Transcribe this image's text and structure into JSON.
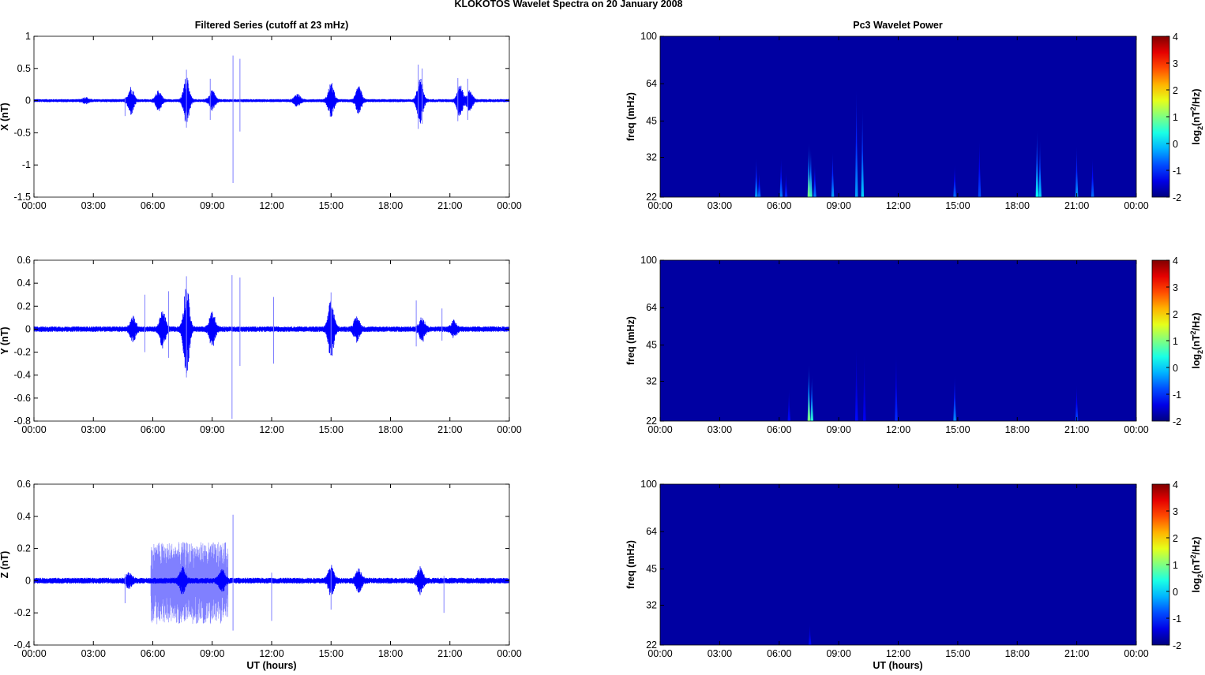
{
  "figure_title": "KLOKOTOS Wavelet Spectra on 20 January   2008",
  "left_title": "Filtered Series (cutoff at 23 mHz)",
  "right_title": "Pc3 Wavelet Power",
  "xlabel": "UT (hours)",
  "colors": {
    "signal": "#0000ff",
    "signal_light": "#8080ff"
  },
  "chart_data": [
    {
      "type": "line",
      "component": "X",
      "ylabel": "X (nT)",
      "xlim": [
        0,
        24
      ],
      "ylim": [
        -1.5,
        1
      ],
      "xticks": [
        "00:00",
        "03:00",
        "06:00",
        "09:00",
        "12:00",
        "15:00",
        "18:00",
        "21:00",
        "00:00"
      ],
      "yticks": [
        1,
        0.5,
        0,
        -0.5,
        -1,
        -1.5
      ],
      "noise_level": 0.02,
      "bursts": [
        {
          "t": 2.6,
          "amp": 0.03
        },
        {
          "t": 4.9,
          "amp": 0.17
        },
        {
          "t": 6.3,
          "amp": 0.12
        },
        {
          "t": 7.7,
          "amp": 0.3
        },
        {
          "t": 9.0,
          "amp": 0.12
        },
        {
          "t": 13.3,
          "amp": 0.08
        },
        {
          "t": 15.0,
          "amp": 0.22
        },
        {
          "t": 16.4,
          "amp": 0.17
        },
        {
          "t": 19.5,
          "amp": 0.3
        },
        {
          "t": 21.5,
          "amp": 0.2
        },
        {
          "t": 22.0,
          "amp": 0.12
        }
      ],
      "spikes": [
        {
          "t": 10.05,
          "max": 0.7,
          "min": -1.28
        },
        {
          "t": 10.4,
          "max": 0.65,
          "min": -0.48
        },
        {
          "t": 7.7,
          "max": 0.48,
          "min": -0.42
        },
        {
          "t": 8.9,
          "max": 0.34,
          "min": -0.3
        },
        {
          "t": 19.4,
          "max": 0.56,
          "min": -0.44
        },
        {
          "t": 19.6,
          "max": 0.5,
          "min": -0.36
        },
        {
          "t": 21.4,
          "max": 0.35,
          "min": -0.32
        },
        {
          "t": 21.9,
          "max": 0.34,
          "min": -0.3
        },
        {
          "t": 4.6,
          "max": 0.05,
          "min": -0.24
        }
      ],
      "light_region": null
    },
    {
      "type": "line",
      "component": "Y",
      "ylabel": "Y (nT)",
      "xlim": [
        0,
        24
      ],
      "ylim": [
        -0.8,
        0.6
      ],
      "xticks": [
        "00:00",
        "03:00",
        "06:00",
        "09:00",
        "12:00",
        "15:00",
        "18:00",
        "21:00",
        "00:00"
      ],
      "yticks": [
        0.6,
        0.4,
        0.2,
        0,
        -0.2,
        -0.4,
        -0.6,
        -0.8
      ],
      "noise_level": 0.02,
      "bursts": [
        {
          "t": 5.0,
          "amp": 0.08
        },
        {
          "t": 6.5,
          "amp": 0.12
        },
        {
          "t": 7.7,
          "amp": 0.32
        },
        {
          "t": 9.0,
          "amp": 0.12
        },
        {
          "t": 15.0,
          "amp": 0.2
        },
        {
          "t": 16.3,
          "amp": 0.08
        },
        {
          "t": 19.6,
          "amp": 0.08
        },
        {
          "t": 21.2,
          "amp": 0.05
        }
      ],
      "spikes": [
        {
          "t": 10.0,
          "max": 0.47,
          "min": -0.78
        },
        {
          "t": 10.4,
          "max": 0.45,
          "min": -0.32
        },
        {
          "t": 7.7,
          "max": 0.46,
          "min": -0.42
        },
        {
          "t": 5.6,
          "max": 0.3,
          "min": -0.2
        },
        {
          "t": 6.8,
          "max": 0.33,
          "min": -0.25
        },
        {
          "t": 12.1,
          "max": 0.28,
          "min": -0.3
        },
        {
          "t": 15.0,
          "max": 0.32,
          "min": -0.22
        },
        {
          "t": 19.3,
          "max": 0.25,
          "min": -0.15
        },
        {
          "t": 20.6,
          "max": 0.18,
          "min": -0.1
        }
      ],
      "light_region": null
    },
    {
      "type": "line",
      "component": "Z",
      "ylabel": "Z (nT)",
      "xlim": [
        0,
        24
      ],
      "ylim": [
        -0.4,
        0.6
      ],
      "xticks": [
        "00:00",
        "03:00",
        "06:00",
        "09:00",
        "12:00",
        "15:00",
        "18:00",
        "21:00",
        "00:00"
      ],
      "yticks": [
        0.6,
        0.4,
        0.2,
        0,
        -0.2,
        -0.4
      ],
      "noise_level": 0.015,
      "bursts": [
        {
          "t": 4.8,
          "amp": 0.03
        },
        {
          "t": 7.5,
          "amp": 0.06
        },
        {
          "t": 9.5,
          "amp": 0.05
        },
        {
          "t": 15.0,
          "amp": 0.07
        },
        {
          "t": 16.4,
          "amp": 0.05
        },
        {
          "t": 19.5,
          "amp": 0.06
        }
      ],
      "spikes": [
        {
          "t": 10.05,
          "max": 0.41,
          "min": -0.31
        },
        {
          "t": 4.6,
          "max": 0.04,
          "min": -0.14
        },
        {
          "t": 12.0,
          "max": 0.05,
          "min": -0.25
        },
        {
          "t": 15.0,
          "max": 0.07,
          "min": -0.18
        },
        {
          "t": 20.7,
          "max": 0.03,
          "min": -0.2
        }
      ],
      "light_region": {
        "start": 5.9,
        "end": 9.8,
        "max": 0.24,
        "min": -0.27
      }
    },
    {
      "type": "heatmap",
      "component": "X",
      "ylabel": "freq (mHz)",
      "yscale": "log",
      "xlim": [
        0,
        24
      ],
      "ylim": [
        22,
        100
      ],
      "xticks": [
        "00:00",
        "03:00",
        "06:00",
        "09:00",
        "12:00",
        "15:00",
        "18:00",
        "21:00",
        "00:00"
      ],
      "yticks": [
        100,
        64,
        45,
        32,
        22
      ],
      "background_power": -1.8,
      "streaks": [
        {
          "t": 4.85,
          "ftop": 32,
          "power": -0.3
        },
        {
          "t": 5.0,
          "ftop": 28,
          "power": -0.6
        },
        {
          "t": 6.1,
          "ftop": 32,
          "power": -0.5
        },
        {
          "t": 6.35,
          "ftop": 28,
          "power": -1.0
        },
        {
          "t": 7.5,
          "ftop": 37,
          "power": 1.0
        },
        {
          "t": 7.6,
          "ftop": 35,
          "power": 0.6
        },
        {
          "t": 7.8,
          "ftop": 30,
          "power": -0.5
        },
        {
          "t": 8.7,
          "ftop": 34,
          "power": -0.3
        },
        {
          "t": 9.9,
          "ftop": 62,
          "power": -0.3
        },
        {
          "t": 10.2,
          "ftop": 52,
          "power": 0.0
        },
        {
          "t": 14.85,
          "ftop": 30,
          "power": -0.6
        },
        {
          "t": 16.1,
          "ftop": 38,
          "power": -0.8
        },
        {
          "t": 19.0,
          "ftop": 42,
          "power": 0.3
        },
        {
          "t": 19.15,
          "ftop": 38,
          "power": 0.0
        },
        {
          "t": 21.0,
          "ftop": 36,
          "power": -0.3
        },
        {
          "t": 21.8,
          "ftop": 32,
          "power": -0.6
        }
      ]
    },
    {
      "type": "heatmap",
      "component": "Y",
      "ylabel": "freq (mHz)",
      "yscale": "log",
      "xlim": [
        0,
        24
      ],
      "ylim": [
        22,
        100
      ],
      "xticks": [
        "00:00",
        "03:00",
        "06:00",
        "09:00",
        "12:00",
        "15:00",
        "18:00",
        "21:00",
        "00:00"
      ],
      "yticks": [
        100,
        64,
        45,
        32,
        22
      ],
      "background_power": -1.8,
      "streaks": [
        {
          "t": 6.5,
          "ftop": 30,
          "power": -1.2
        },
        {
          "t": 7.5,
          "ftop": 38,
          "power": 1.0
        },
        {
          "t": 7.65,
          "ftop": 34,
          "power": 0.5
        },
        {
          "t": 9.9,
          "ftop": 45,
          "power": -1.2
        },
        {
          "t": 10.3,
          "ftop": 42,
          "power": -1.3
        },
        {
          "t": 11.9,
          "ftop": 42,
          "power": -1.0
        },
        {
          "t": 14.85,
          "ftop": 34,
          "power": -0.4
        },
        {
          "t": 21.0,
          "ftop": 31,
          "power": -0.8
        }
      ]
    },
    {
      "type": "heatmap",
      "component": "Z",
      "ylabel": "freq (mHz)",
      "yscale": "log",
      "xlim": [
        0,
        24
      ],
      "ylim": [
        22,
        100
      ],
      "xticks": [
        "00:00",
        "03:00",
        "06:00",
        "09:00",
        "12:00",
        "15:00",
        "18:00",
        "21:00",
        "00:00"
      ],
      "yticks": [
        100,
        64,
        45,
        32,
        22
      ],
      "background_power": -1.8,
      "streaks": [
        {
          "t": 7.55,
          "ftop": 27,
          "power": -1.2
        }
      ]
    }
  ],
  "colorbar": {
    "range": [
      -2,
      4
    ],
    "ticks": [
      4,
      3,
      2,
      1,
      0,
      -1,
      -2
    ],
    "label_base": "log",
    "label_sub": "2",
    "label_mid": "(nT",
    "label_sup": "2",
    "label_end": "/Hz)"
  }
}
